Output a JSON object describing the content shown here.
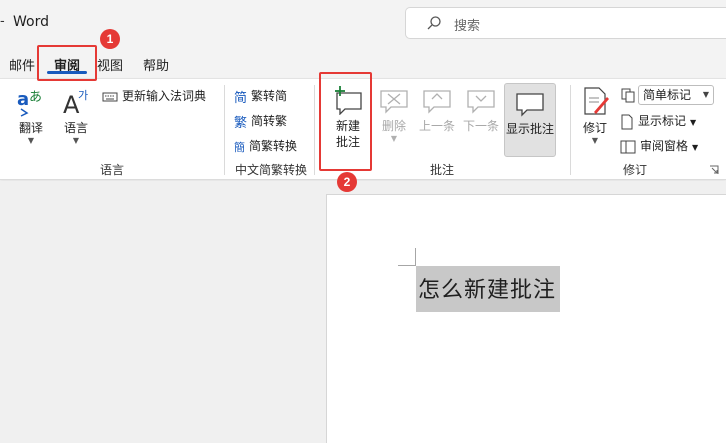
{
  "window": {
    "title_prefix": "-",
    "app_title": "Word"
  },
  "search": {
    "placeholder": "搜索",
    "icon": "search-icon"
  },
  "tabs": [
    {
      "label": "邮件",
      "active": false
    },
    {
      "label": "审阅",
      "active": true
    },
    {
      "label": "视图",
      "active": false
    },
    {
      "label": "帮助",
      "active": false
    }
  ],
  "ribbon": {
    "language_group": {
      "label": "语言",
      "translate_label": "翻译",
      "language_label": "语言",
      "update_ime_label": "更新输入法词典"
    },
    "chinese_conversion_group": {
      "label": "中文简繁转换",
      "trad_to_simp_label": "繁转简",
      "simp_to_trad_label": "简转繁",
      "convert_label": "简繁转换"
    },
    "comments_group": {
      "label": "批注",
      "new_comment_line1": "新建",
      "new_comment_line2": "批注",
      "delete_label": "删除",
      "previous_label": "上一条",
      "next_label": "下一条",
      "show_comments_label": "显示批注"
    },
    "tracking_group": {
      "label": "修订",
      "track_changes_label": "修订",
      "markup_dropdown_value": "简单标记",
      "show_markup_label": "显示标记",
      "reviewing_pane_label": "审阅窗格"
    }
  },
  "document": {
    "text": "怎么新建批注"
  },
  "annotations": {
    "badge_1": "1",
    "badge_2": "2"
  },
  "colors": {
    "accent": "#185abd",
    "callout": "#e53935",
    "selection": "#c8c8c8"
  }
}
